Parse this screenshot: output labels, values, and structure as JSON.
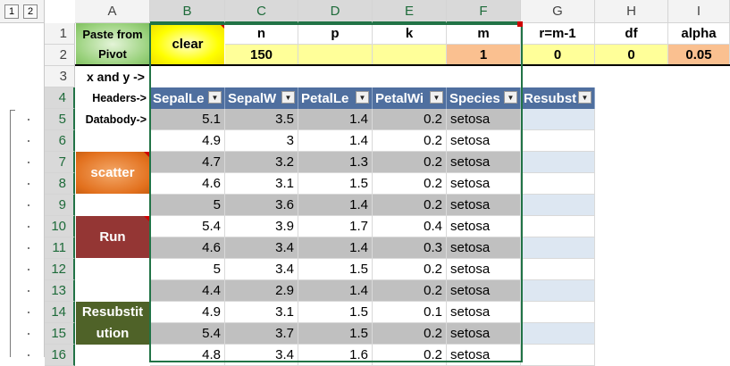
{
  "outline": {
    "levels": [
      "1",
      "2"
    ]
  },
  "columns": [
    "A",
    "B",
    "C",
    "D",
    "E",
    "F",
    "G",
    "H",
    "I"
  ],
  "rows": [
    "1",
    "2",
    "3",
    "4",
    "5",
    "6",
    "7",
    "8",
    "9",
    "10",
    "11",
    "12",
    "13",
    "14",
    "15",
    "16"
  ],
  "buttons": {
    "paste_line1": "Paste from",
    "paste_line2": "Pivot",
    "clear": "clear",
    "scatter": "scatter",
    "run": "Run",
    "resub_line1": "Resubstit",
    "resub_line2": "ution"
  },
  "params": {
    "headers": [
      "n",
      "p",
      "k",
      "m",
      "r=m-1",
      "df",
      "alpha"
    ],
    "values": [
      "150",
      "",
      "",
      "1",
      "0",
      "0",
      "0.05"
    ]
  },
  "labels": {
    "xy": "x and y ->",
    "headers": "Headers->",
    "databody": "Databody->"
  },
  "table": {
    "headers": [
      "SepalLe",
      "SepalW",
      "PetalLe",
      "PetalWi",
      "Species",
      "Resubst"
    ],
    "rows": [
      [
        "5.1",
        "3.5",
        "1.4",
        "0.2",
        "setosa"
      ],
      [
        "4.9",
        "3",
        "1.4",
        "0.2",
        "setosa"
      ],
      [
        "4.7",
        "3.2",
        "1.3",
        "0.2",
        "setosa"
      ],
      [
        "4.6",
        "3.1",
        "1.5",
        "0.2",
        "setosa"
      ],
      [
        "5",
        "3.6",
        "1.4",
        "0.2",
        "setosa"
      ],
      [
        "5.4",
        "3.9",
        "1.7",
        "0.4",
        "setosa"
      ],
      [
        "4.6",
        "3.4",
        "1.4",
        "0.3",
        "setosa"
      ],
      [
        "5",
        "3.4",
        "1.5",
        "0.2",
        "setosa"
      ],
      [
        "4.4",
        "2.9",
        "1.4",
        "0.2",
        "setosa"
      ],
      [
        "4.9",
        "3.1",
        "1.5",
        "0.1",
        "setosa"
      ],
      [
        "5.4",
        "3.7",
        "1.5",
        "0.2",
        "setosa"
      ],
      [
        "4.8",
        "3.4",
        "1.6",
        "0.2",
        "setosa"
      ]
    ]
  },
  "colors": {
    "paste_btn": "#9bd27e",
    "clear_btn": "#ffff00",
    "scatter_btn": "#e2701d",
    "run_btn": "#943634",
    "resub_btn": "#4f6228",
    "param_yellow": "#ffff99",
    "param_orange": "#fac090",
    "table_header": "#4f6f9f",
    "table_gray": "#c0c0c0",
    "resub_band": "#dde7f2",
    "selection": "#217346"
  }
}
